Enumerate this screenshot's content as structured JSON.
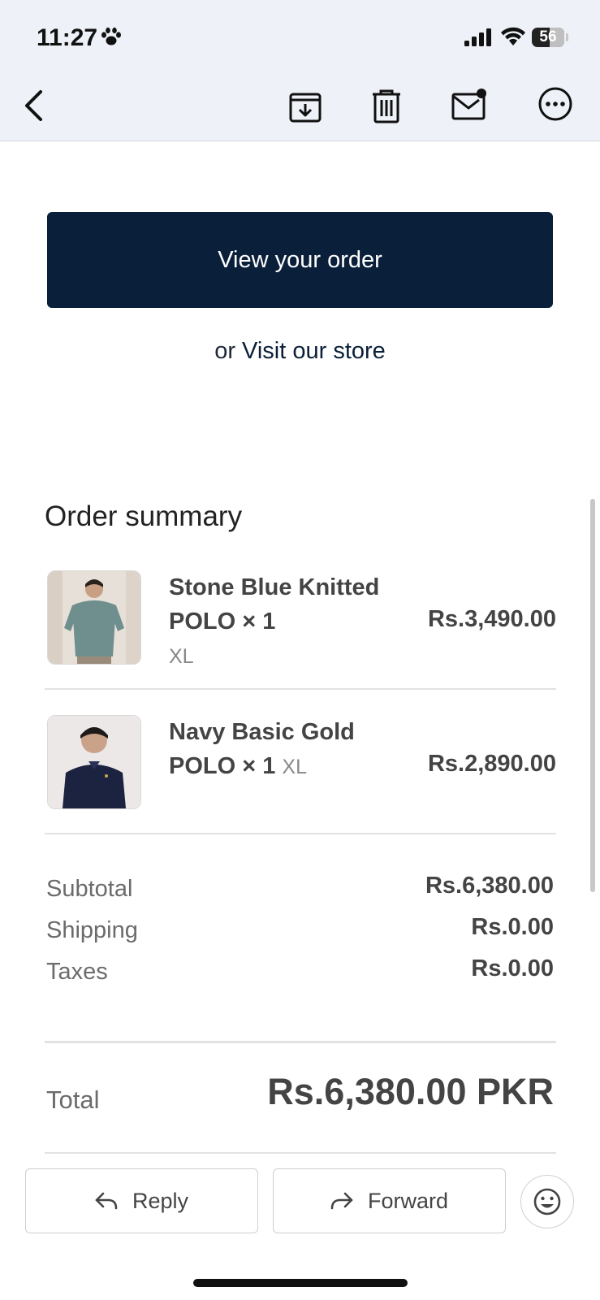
{
  "status_bar": {
    "time": "11:27",
    "battery": "56"
  },
  "toolbar": {
    "back": "back-icon",
    "archive": "archive-icon",
    "delete": "trash-icon",
    "mark_unread": "unread-mail-icon",
    "more": "more-icon"
  },
  "email": {
    "view_order_label": "View your order",
    "store_prefix": "or",
    "store_link": "Visit our store",
    "summary_title": "Order summary",
    "items": [
      {
        "name": "Stone Blue Knitted POLO × 1",
        "variant": "XL",
        "price": "Rs.3,490.00"
      },
      {
        "name": "Navy Basic Gold POLO × 1",
        "variant": "XL",
        "price": "Rs.2,890.00"
      }
    ],
    "totals": [
      {
        "label": "Subtotal",
        "value": "Rs.6,380.00"
      },
      {
        "label": "Shipping",
        "value": "Rs.0.00"
      },
      {
        "label": "Taxes",
        "value": "Rs.0.00"
      }
    ],
    "total_label": "Total",
    "total_value": "Rs.6,380.00 PKR"
  },
  "actions": {
    "reply": "Reply",
    "forward": "Forward",
    "emoji": "emoji-icon"
  }
}
